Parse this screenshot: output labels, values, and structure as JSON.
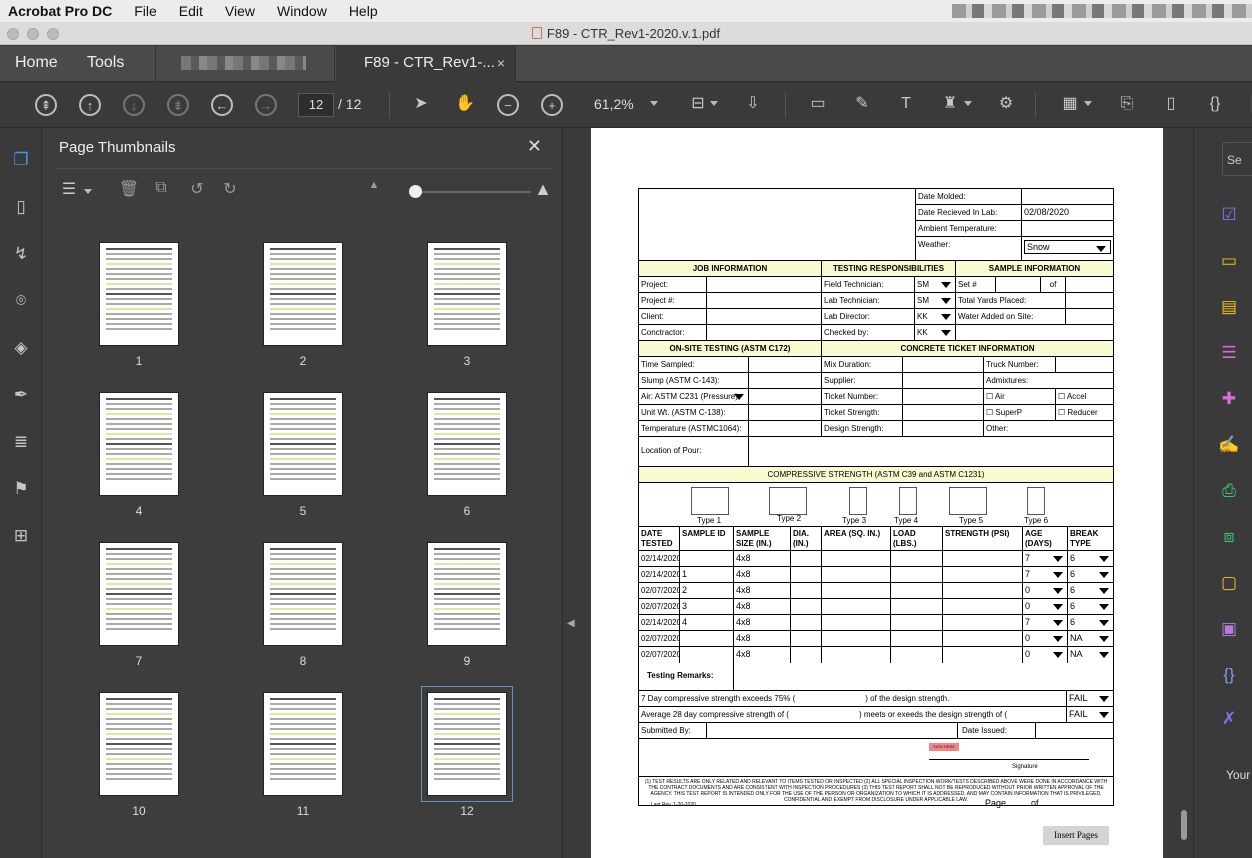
{
  "menubar": {
    "app": "Acrobat Pro DC",
    "items": [
      "File",
      "Edit",
      "View",
      "Window",
      "Help"
    ]
  },
  "window": {
    "title": "F89 - CTR_Rev1-2020.v.1.pdf"
  },
  "tabs": {
    "home": "Home",
    "tools": "Tools",
    "doc": "F89 - CTR_Rev1-...",
    "close": "×"
  },
  "toolbar": {
    "page_current": "12",
    "page_total": "/ 12",
    "zoom": "61,2%"
  },
  "thumbnails": {
    "title": "Page Thumbnails",
    "pages": [
      "1",
      "2",
      "3",
      "4",
      "5",
      "6",
      "7",
      "8",
      "9",
      "10",
      "11",
      "12"
    ],
    "selected": "12"
  },
  "form": {
    "date_molded": "Date Molded:",
    "date_received": "Date Recieved In Lab:",
    "date_received_val": "02/08/2020",
    "ambient": "Ambient Temperature:",
    "weather": "Weather:",
    "weather_val": "Snow",
    "job_info": "JOB INFORMATION",
    "testing_resp": "TESTING RESPONSIBILITIES",
    "sample_info": "SAMPLE INFORMATION",
    "project": "Project:",
    "field_tech": "Field Technician:",
    "field_tech_val": "SM",
    "set_no": "Set #",
    "of": "of",
    "project_no": "Project #:",
    "lab_tech": "Lab Technician:",
    "lab_tech_val": "SM",
    "total_yards": "Total Yards Placed:",
    "client": "Client:",
    "lab_dir": "Lab Director:",
    "lab_dir_val": "KK",
    "water_added": "Water Added on Site:",
    "contractor": "Conctractor:",
    "checked_by": "Checked by:",
    "checked_by_val": "KK",
    "onsite": "ON-SITE TESTING (ASTM C172)",
    "ticket_info": "CONCRETE TICKET INFORMATION",
    "time_sampled": "Time Sampled:",
    "mix_duration": "Mix Duration:",
    "truck_no": "Truck Number:",
    "slump": "Slump (ASTM C-143):",
    "supplier": "Supplier:",
    "admixtures": "Admixtures:",
    "air": "Air: ASTM C231 (Pressure)",
    "ticket_no": "Ticket Number:",
    "air_opt": "Air",
    "accel": "Accel",
    "unit_wt": "Unit Wt. (ASTM C-138):",
    "ticket_strength": "Ticket Strength:",
    "superp": "SuperP",
    "reducer": "Reducer",
    "temperature": "Temperature (ASTMC1064):",
    "design_strength": "Design Strength:",
    "other": "Other:",
    "location": "Location of Pour:",
    "comp_strength": "COMPRESSIVE STRENGTH (ASTM C39 and ASTM C1231)",
    "types": [
      "Type 1",
      "Type 2",
      "Type 3",
      "Type 4",
      "Type 5",
      "Type 6"
    ],
    "columns": [
      "DATE TESTED",
      "SAMPLE ID",
      "SAMPLE SIZE (IN.)",
      "DIA. (IN.)",
      "AREA (SQ. IN.)",
      "LOAD (LBS.)",
      "STRENGTH (PSI)",
      "AGE (DAYS)",
      "BREAK TYPE"
    ],
    "rows": [
      {
        "date": "02/14/2020",
        "id": "",
        "size": "4x8",
        "age": "7",
        "brk": "6"
      },
      {
        "date": "02/14/2020",
        "id": "1",
        "size": "4x8",
        "age": "7",
        "brk": "6"
      },
      {
        "date": "02/07/2020",
        "id": "2",
        "size": "4x8",
        "age": "0",
        "brk": "6"
      },
      {
        "date": "02/07/2020",
        "id": "3",
        "size": "4x8",
        "age": "0",
        "brk": "6"
      },
      {
        "date": "02/14/2020",
        "id": "4",
        "size": "4x8",
        "age": "7",
        "brk": "6"
      },
      {
        "date": "02/07/2020",
        "id": "",
        "size": "4x8",
        "age": "0",
        "brk": "NA"
      },
      {
        "date": "02/07/2020",
        "id": "",
        "size": "4x8",
        "age": "0",
        "brk": "NA"
      }
    ],
    "remarks": "Testing Remarks:",
    "r7_a": "7 Day compressive strength exceeds 75% (",
    "r7_b": ") of the design strength.",
    "r7_val": "FAIL",
    "r28_a": "Average 28 day compressive strength of (",
    "r28_b": ") meets or exeeds the design strength of (",
    "r28_c": ").",
    "r28_val": "FAIL",
    "submitted": "Submitted By:",
    "date_issued": "Date Issued:",
    "sign_here": "SIGN HERE",
    "signature": "Signature",
    "disclaimer": "(1) TEST RESULTS ARE ONLY RELATED AND RELEVANT TO ITEMS TESTED OR INSPECTED (2) ALL SPECIAL INSPECTION WORK/TESTS DESCRIBED ABOVE WERE DONE IN ACCORDANCE WITH THE CONTRACT DOCUMENTS AND ARE CONSISTENT WITH INSPECTION PROCEDURES (3) THIS TEST REPORT SHALL NOT BE REPRODUCED WITHOUT PRIOR WRITTEN APPROVAL OF THE AGENCY. THIS TEST REPORT IS INTENDED ONLY FOR THE USE OF THE PERSON OR ORGANIZATION TO WHICH IT IS ADDRESSED, AND MAY CONTAIN INFORMATION THAT IS PRIVILEGED, CONFIDENTIAL AND EXEMPT FROM DISCLOSURE UNDER APPLICABLE LAW.",
    "last_rev": "Last Rev. 1-20-2020",
    "page_label": "Page",
    "page_of": "of",
    "insert_pages": "Insert Pages"
  },
  "right_panel": {
    "search": "Se",
    "your": "Your"
  }
}
